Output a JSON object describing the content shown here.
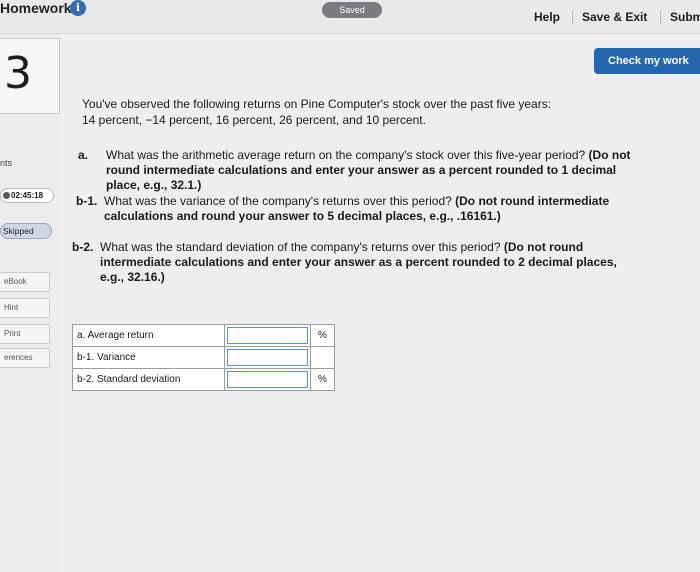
{
  "header": {
    "title": "Homework9",
    "info_icon": "info-icon",
    "saved_label": "Saved",
    "help_label": "Help",
    "save_exit_label": "Save & Exit",
    "submit_label": "Subm"
  },
  "rail": {
    "points_label": "nts",
    "timer": "02:45:18",
    "skipped_label": "Skipped",
    "ebook_label": "eBook",
    "hint_label": "Hint",
    "print_label": "Print",
    "references_label": "erences"
  },
  "question": {
    "number": "3",
    "check_label": "Check my work",
    "stem_line1": "You've observed the following returns on Pine Computer's stock over the past five years:",
    "stem_line2": "14 percent, −14 percent, 16 percent, 26 percent, and 10 percent.",
    "parts": [
      {
        "tag": "a.",
        "text": "What was the arithmetic average return on the company's stock over this five-year period?",
        "instruction": "(Do not round intermediate calculations and enter your answer as a percent rounded to 1 decimal place, e.g., 32.1.)"
      },
      {
        "tag": "b-1.",
        "text": "What was the variance of the company's returns over this period?",
        "instruction": "(Do not round intermediate calculations and round your answer to 5 decimal places, e.g., .16161.)"
      },
      {
        "tag": "b-2.",
        "text": "What was the standard deviation of the company's returns over this period?",
        "instruction": "(Do not round intermediate calculations and enter your answer as a percent rounded to 2 decimal places, e.g., 32.16.)"
      }
    ]
  },
  "answers": {
    "rows": [
      {
        "label": "a. Average return",
        "value": "",
        "unit": "%"
      },
      {
        "label": "b-1. Variance",
        "value": "",
        "unit": ""
      },
      {
        "label": "b-2. Standard deviation",
        "value": "",
        "unit": "%"
      }
    ]
  }
}
